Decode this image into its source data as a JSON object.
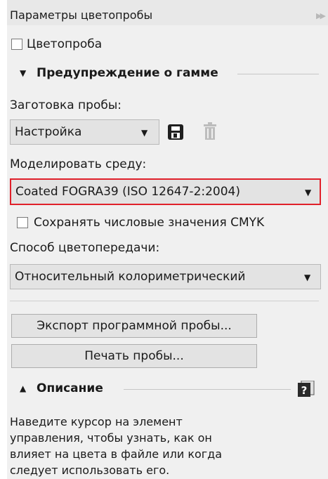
{
  "panel": {
    "title": "Параметры цветопробы",
    "accent_color": "#e0202a"
  },
  "proof": {
    "checkbox_label": "Цветопроба",
    "checked": false
  },
  "gamut_section": {
    "title": "Предупреждение о гамме"
  },
  "preset": {
    "label": "Заготовка пробы:",
    "value": "Настройка"
  },
  "simulate": {
    "label": "Моделировать среду:",
    "value": "Coated FOGRA39 (ISO 12647-2:2004)",
    "highlight_color": "#e0202a"
  },
  "preserve": {
    "checkbox_label": "Сохранять числовые значения CMYK",
    "checked": false
  },
  "intent": {
    "label": "Способ цветопередачи:",
    "value": "Относительный колориметрический"
  },
  "buttons": {
    "export_label": "Экспорт программной пробы...",
    "print_label": "Печать пробы..."
  },
  "description_section": {
    "title": "Описание",
    "help_text": "Наведите курсор на элемент\nуправления, чтобы узнать, как он\nвлияет на цвета в файле или когда\nследует использовать его."
  },
  "icons": {
    "collapse": "double-chevron-right-icon",
    "save": "save-disk-icon",
    "delete": "trash-icon",
    "help": "help-question-icon",
    "dropdown": "triangle-down-icon"
  }
}
